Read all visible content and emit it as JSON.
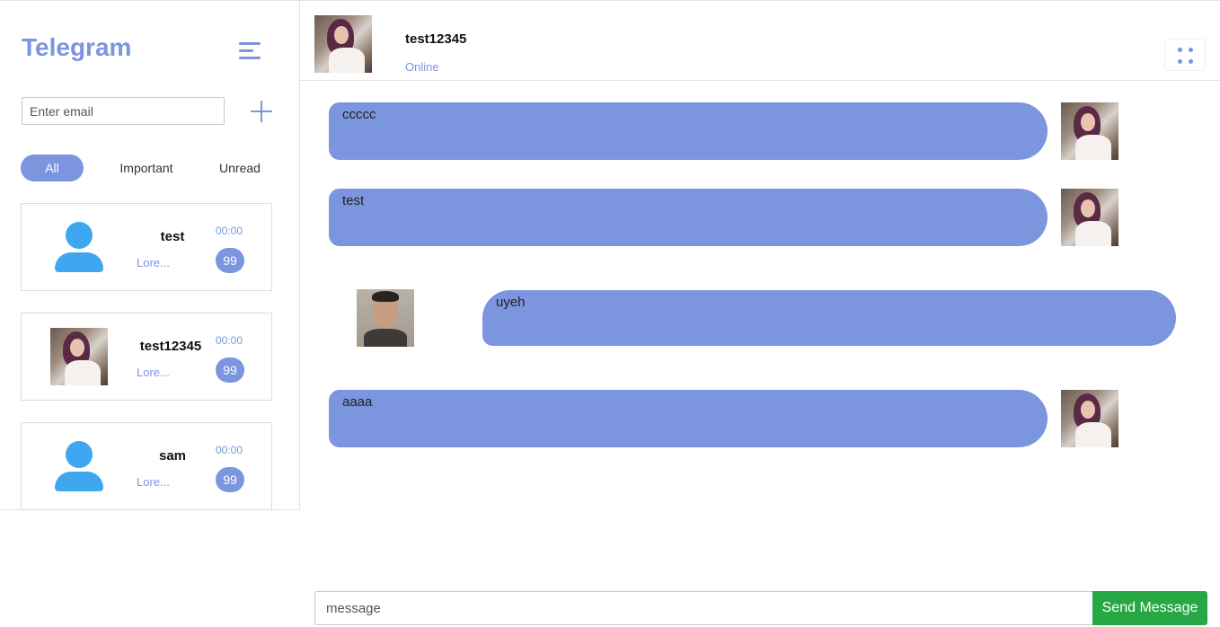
{
  "sidebar": {
    "brand": "Telegram",
    "search": {
      "placeholder": "Enter email",
      "value": ""
    },
    "tabs": [
      {
        "label": "All",
        "active": true
      },
      {
        "label": "Important",
        "active": false
      },
      {
        "label": "Unread",
        "active": false
      }
    ],
    "contacts": [
      {
        "name": "test",
        "preview": "Lore...",
        "time": "00:00",
        "unread": "99",
        "avatar": "person-icon"
      },
      {
        "name": "test12345",
        "preview": "Lore...",
        "time": "00:00",
        "unread": "99",
        "avatar": "photo"
      },
      {
        "name": "sam",
        "preview": "Lore...",
        "time": "00:00",
        "unread": "99",
        "avatar": "person-icon"
      }
    ]
  },
  "chat": {
    "name": "test12345",
    "status": "Online",
    "messages": [
      {
        "text": "ccccc",
        "from": "me"
      },
      {
        "text": "test",
        "from": "me"
      },
      {
        "text": "uyeh",
        "from": "other"
      },
      {
        "text": "aaaa",
        "from": "me"
      }
    ],
    "composer": {
      "placeholder": "message",
      "value": "",
      "send_label": "Send Message"
    }
  },
  "colors": {
    "accent": "#7b95de",
    "avatar_icon": "#3fa7ef",
    "send_button": "#28a745"
  }
}
